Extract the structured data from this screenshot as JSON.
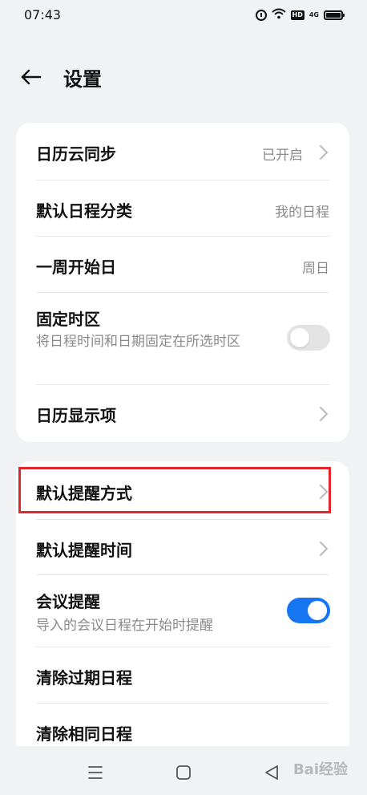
{
  "status_bar": {
    "time": "07:43",
    "icons": [
      "alarm-icon",
      "wifi-icon",
      "hd-icon",
      "network-4g-icon",
      "battery-icon"
    ],
    "hd_label": "HD",
    "network_label": "4G"
  },
  "header": {
    "title": "设置",
    "back_icon": "arrow-left-icon"
  },
  "card1": {
    "items": [
      {
        "label": "日历云同步",
        "value": "已开启",
        "has_chevron": true
      },
      {
        "label": "默认日程分类",
        "value": "我的日程",
        "has_chevron": false
      },
      {
        "label": "一周开始日",
        "value": "周日",
        "has_chevron": false
      },
      {
        "label": "固定时区",
        "sublabel": "将日程时间和日期固定在所选时区",
        "toggle": false
      },
      {
        "label": "日历显示项",
        "has_chevron": true
      }
    ]
  },
  "card2": {
    "items": [
      {
        "label": "默认提醒方式",
        "has_chevron": true
      },
      {
        "label": "默认提醒时间",
        "has_chevron": true
      },
      {
        "label": "会议提醒",
        "sublabel": "导入的会议日程在开始时提醒",
        "toggle": true
      },
      {
        "label": "清除过期日程"
      },
      {
        "label": "清除相同日程"
      }
    ]
  },
  "colors": {
    "background": "#f1f2f4",
    "card": "#ffffff",
    "accent": "#1676f2",
    "highlight_border": "#e3262d"
  },
  "navbar": {
    "buttons": [
      "menu-icon",
      "home-icon",
      "back-triangle-icon"
    ]
  },
  "watermark": "Bai经验"
}
